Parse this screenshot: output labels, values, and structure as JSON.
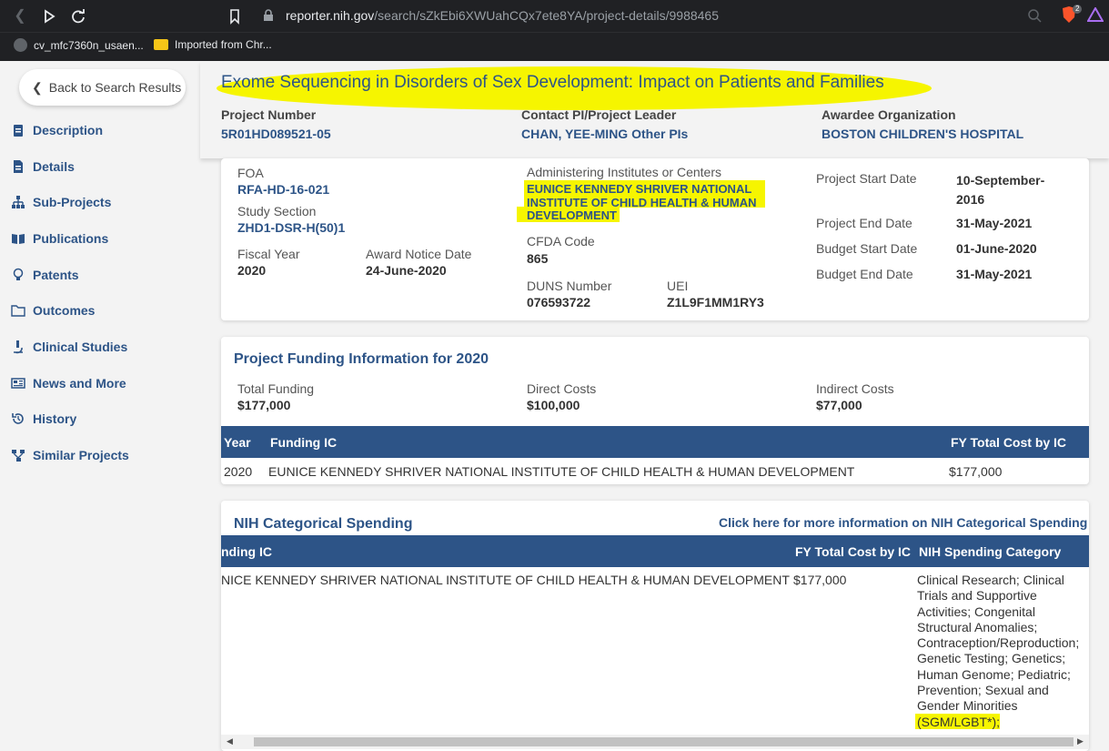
{
  "browser": {
    "url_host": "reporter.nih.gov",
    "url_path": "/search/sZkEbi6XWUahCQx7ete8YA/project-details/9988465",
    "brave_badge": "2",
    "bookmarks": [
      {
        "label": "cv_mfc7360n_usaen..."
      },
      {
        "label": "Imported from Chr..."
      }
    ]
  },
  "sidebar": {
    "back_label": "Back to Search Results",
    "items": [
      {
        "label": "Description",
        "icon": "clipboard-icon"
      },
      {
        "label": "Details",
        "icon": "document-icon"
      },
      {
        "label": "Sub-Projects",
        "icon": "sitemap-icon"
      },
      {
        "label": "Publications",
        "icon": "book-icon"
      },
      {
        "label": "Patents",
        "icon": "lightbulb-icon"
      },
      {
        "label": "Outcomes",
        "icon": "folder-icon"
      },
      {
        "label": "Clinical Studies",
        "icon": "microscope-icon"
      },
      {
        "label": "News and More",
        "icon": "newspaper-icon"
      },
      {
        "label": "History",
        "icon": "history-icon"
      },
      {
        "label": "Similar Projects",
        "icon": "network-icon"
      }
    ]
  },
  "header": {
    "title": "Exome Sequencing in Disorders of Sex Development: Impact on Patients and Families",
    "project_number_label": "Project Number",
    "project_number": "5R01HD089521-05",
    "contact_pi_label": "Contact PI/Project Leader",
    "contact_pi": "CHAN, YEE-MING",
    "other_pis": "Other PIs",
    "awardee_label": "Awardee Organization",
    "awardee": "BOSTON CHILDREN'S HOSPITAL"
  },
  "details": {
    "foa_label": "FOA",
    "foa": "RFA-HD-16-021",
    "study_section_label": "Study Section",
    "study_section": "ZHD1-DSR-H(50)1",
    "fiscal_year_label": "Fiscal Year",
    "fiscal_year": "2020",
    "award_notice_label": "Award Notice Date",
    "award_notice": "24-June-2020",
    "admin_ic_label": "Administering Institutes or Centers",
    "admin_ic_lines": [
      "EUNICE KENNEDY SHRIVER NATIONAL",
      "INSTITUTE OF CHILD HEALTH & HUMAN",
      "DEVELOPMENT"
    ],
    "cfda_label": "CFDA Code",
    "cfda": "865",
    "duns_label": "DUNS Number",
    "duns": "076593722",
    "uei_label": "UEI",
    "uei": "Z1L9F1MM1RY3",
    "start_label": "Project Start Date",
    "start_lines": [
      "10-September-",
      "2016"
    ],
    "end_label": "Project End Date",
    "end": "31-May-2021",
    "budget_start_label": "Budget Start Date",
    "budget_start": "01-June-2020",
    "budget_end_label": "Budget End Date",
    "budget_end": "31-May-2021"
  },
  "funding": {
    "title": "Project Funding Information for 2020",
    "total_label": "Total Funding",
    "total": "$177,000",
    "direct_label": "Direct Costs",
    "direct": "$100,000",
    "indirect_label": "Indirect Costs",
    "indirect": "$77,000",
    "columns": [
      "Year",
      "Funding IC",
      "FY Total Cost by IC"
    ],
    "row": {
      "year": "2020",
      "ic": "EUNICE KENNEDY SHRIVER NATIONAL INSTITUTE OF CHILD HEALTH & HUMAN DEVELOPMENT",
      "cost": "$177,000"
    }
  },
  "spending": {
    "title": "NIH Categorical Spending",
    "more_link": "Click here for more information on NIH Categorical Spending",
    "columns": [
      "nding IC",
      "FY Total Cost by IC",
      "NIH Spending Category"
    ],
    "row": {
      "ic": "NICE KENNEDY SHRIVER NATIONAL INSTITUTE OF CHILD HEALTH & HUMAN DEVELOPMENT",
      "cost": "$177,000",
      "category_lines": [
        "Clinical Research; Clinical",
        "Trials and Supportive",
        "Activities; Congenital",
        "Structural Anomalies;",
        "Contraception/Reproduction;",
        "Genetic Testing; Genetics;",
        "Human Genome; Pediatric;",
        "Prevention; Sexual and",
        "Gender Minorities",
        "(SGM/LGBT*);"
      ]
    }
  },
  "colors": {
    "accent": "#2d5487",
    "highlight": "#f6f500"
  }
}
